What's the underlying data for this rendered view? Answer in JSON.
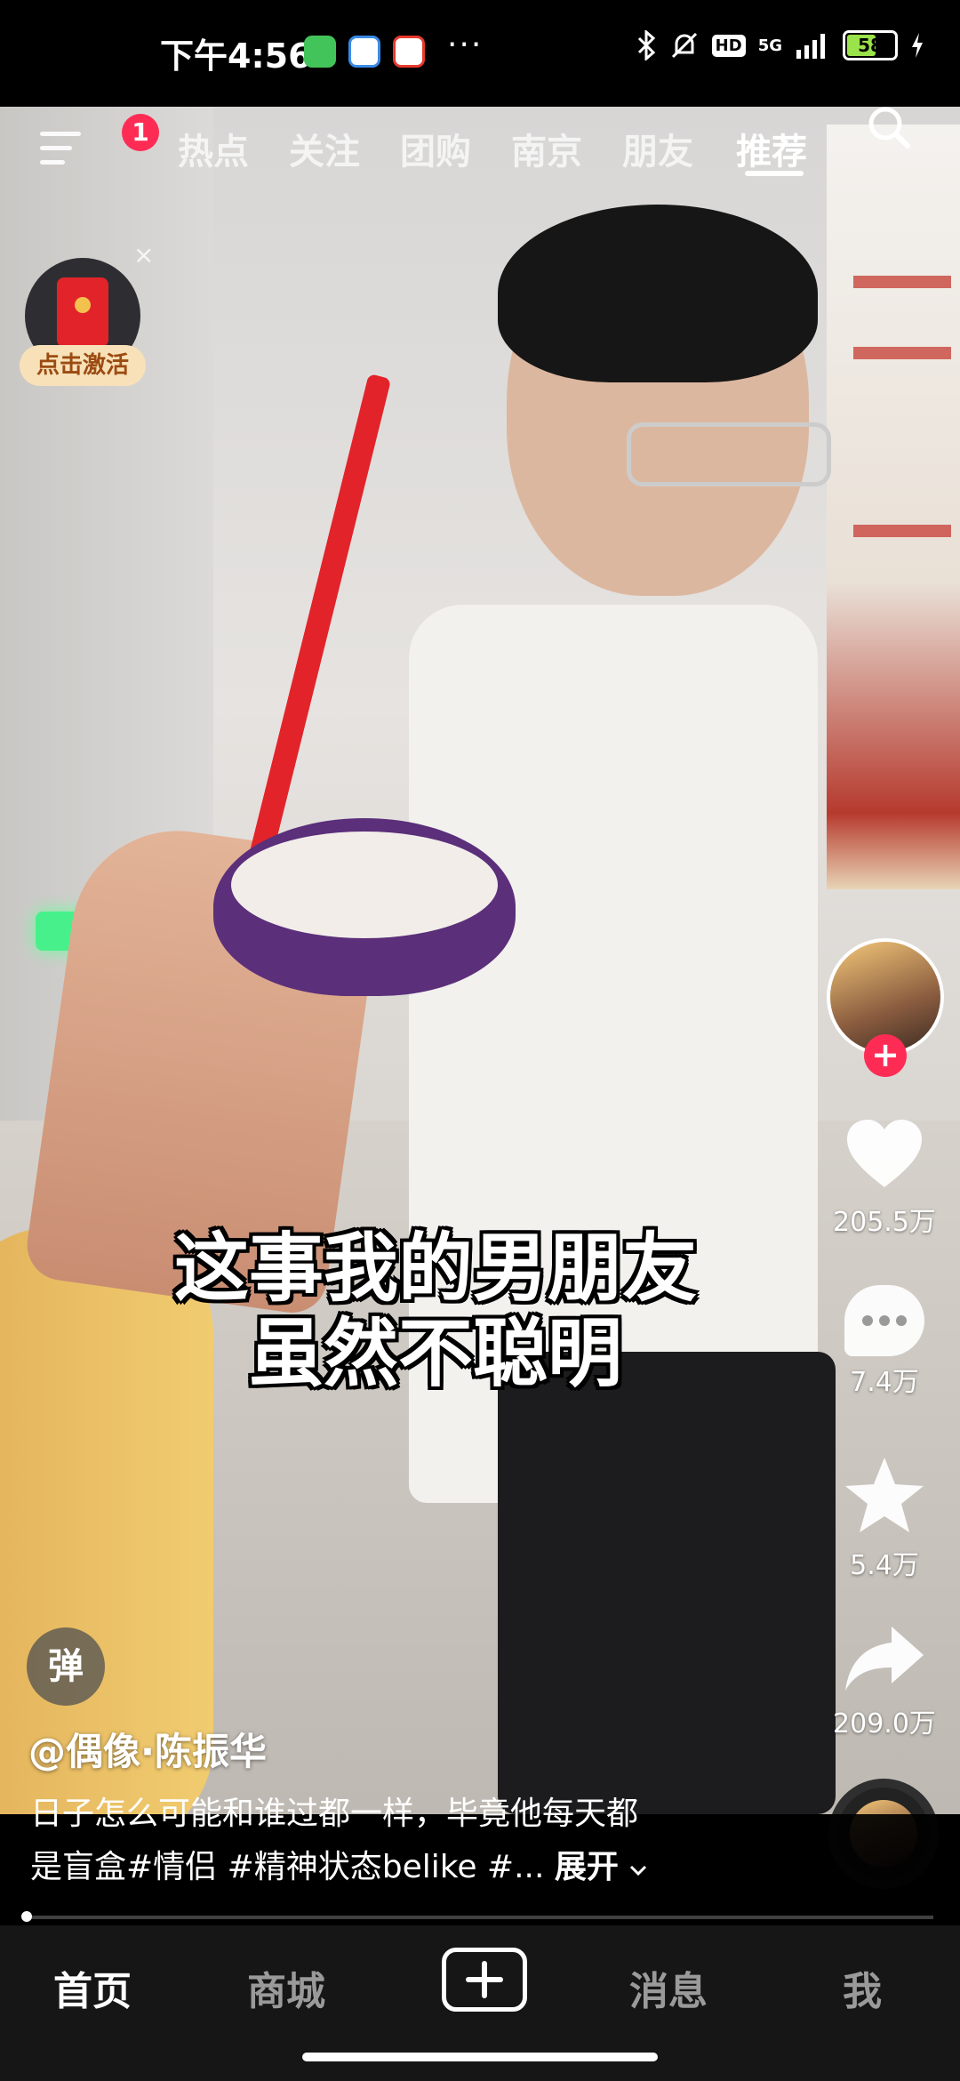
{
  "status_bar": {
    "time": "下午4:56",
    "battery": "58",
    "network": "5G",
    "hd": "HD"
  },
  "top_tabs": {
    "menu_badge": "1",
    "items": [
      "热点",
      "关注",
      "团购",
      "南京",
      "朋友",
      "推荐"
    ],
    "active_index": 5
  },
  "red_packet": {
    "label": "点击激活",
    "close": "×"
  },
  "subtitle": {
    "line1": "这事我的男朋友",
    "line2": "虽然不聪明"
  },
  "actions": {
    "likes": "205.5万",
    "comments": "7.4万",
    "favorites": "5.4万",
    "shares": "209.0万"
  },
  "danmaku": {
    "label": "弹"
  },
  "post": {
    "author": "@偶像·陈振华",
    "caption_line1": "日子怎么可能和谁过都一样，毕竟他每天都",
    "caption_line2": "是盲盒#情侣 #精神状态belike #...",
    "expand": "展开"
  },
  "bottom_nav": {
    "home": "首页",
    "mall": "商城",
    "messages": "消息",
    "me": "我"
  },
  "colors": {
    "accent": "#fe2c55",
    "nav_bg": "#161616"
  }
}
